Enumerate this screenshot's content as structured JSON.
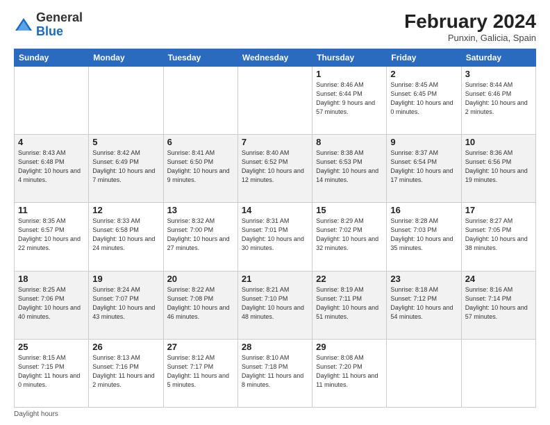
{
  "header": {
    "logo_general": "General",
    "logo_blue": "Blue",
    "month_year": "February 2024",
    "location": "Punxin, Galicia, Spain"
  },
  "weekdays": [
    "Sunday",
    "Monday",
    "Tuesday",
    "Wednesday",
    "Thursday",
    "Friday",
    "Saturday"
  ],
  "footer": {
    "daylight_label": "Daylight hours"
  },
  "weeks": [
    [
      {
        "day": "",
        "info": ""
      },
      {
        "day": "",
        "info": ""
      },
      {
        "day": "",
        "info": ""
      },
      {
        "day": "",
        "info": ""
      },
      {
        "day": "1",
        "info": "Sunrise: 8:46 AM\nSunset: 6:44 PM\nDaylight: 9 hours\nand 57 minutes."
      },
      {
        "day": "2",
        "info": "Sunrise: 8:45 AM\nSunset: 6:45 PM\nDaylight: 10 hours\nand 0 minutes."
      },
      {
        "day": "3",
        "info": "Sunrise: 8:44 AM\nSunset: 6:46 PM\nDaylight: 10 hours\nand 2 minutes."
      }
    ],
    [
      {
        "day": "4",
        "info": "Sunrise: 8:43 AM\nSunset: 6:48 PM\nDaylight: 10 hours\nand 4 minutes."
      },
      {
        "day": "5",
        "info": "Sunrise: 8:42 AM\nSunset: 6:49 PM\nDaylight: 10 hours\nand 7 minutes."
      },
      {
        "day": "6",
        "info": "Sunrise: 8:41 AM\nSunset: 6:50 PM\nDaylight: 10 hours\nand 9 minutes."
      },
      {
        "day": "7",
        "info": "Sunrise: 8:40 AM\nSunset: 6:52 PM\nDaylight: 10 hours\nand 12 minutes."
      },
      {
        "day": "8",
        "info": "Sunrise: 8:38 AM\nSunset: 6:53 PM\nDaylight: 10 hours\nand 14 minutes."
      },
      {
        "day": "9",
        "info": "Sunrise: 8:37 AM\nSunset: 6:54 PM\nDaylight: 10 hours\nand 17 minutes."
      },
      {
        "day": "10",
        "info": "Sunrise: 8:36 AM\nSunset: 6:56 PM\nDaylight: 10 hours\nand 19 minutes."
      }
    ],
    [
      {
        "day": "11",
        "info": "Sunrise: 8:35 AM\nSunset: 6:57 PM\nDaylight: 10 hours\nand 22 minutes."
      },
      {
        "day": "12",
        "info": "Sunrise: 8:33 AM\nSunset: 6:58 PM\nDaylight: 10 hours\nand 24 minutes."
      },
      {
        "day": "13",
        "info": "Sunrise: 8:32 AM\nSunset: 7:00 PM\nDaylight: 10 hours\nand 27 minutes."
      },
      {
        "day": "14",
        "info": "Sunrise: 8:31 AM\nSunset: 7:01 PM\nDaylight: 10 hours\nand 30 minutes."
      },
      {
        "day": "15",
        "info": "Sunrise: 8:29 AM\nSunset: 7:02 PM\nDaylight: 10 hours\nand 32 minutes."
      },
      {
        "day": "16",
        "info": "Sunrise: 8:28 AM\nSunset: 7:03 PM\nDaylight: 10 hours\nand 35 minutes."
      },
      {
        "day": "17",
        "info": "Sunrise: 8:27 AM\nSunset: 7:05 PM\nDaylight: 10 hours\nand 38 minutes."
      }
    ],
    [
      {
        "day": "18",
        "info": "Sunrise: 8:25 AM\nSunset: 7:06 PM\nDaylight: 10 hours\nand 40 minutes."
      },
      {
        "day": "19",
        "info": "Sunrise: 8:24 AM\nSunset: 7:07 PM\nDaylight: 10 hours\nand 43 minutes."
      },
      {
        "day": "20",
        "info": "Sunrise: 8:22 AM\nSunset: 7:08 PM\nDaylight: 10 hours\nand 46 minutes."
      },
      {
        "day": "21",
        "info": "Sunrise: 8:21 AM\nSunset: 7:10 PM\nDaylight: 10 hours\nand 48 minutes."
      },
      {
        "day": "22",
        "info": "Sunrise: 8:19 AM\nSunset: 7:11 PM\nDaylight: 10 hours\nand 51 minutes."
      },
      {
        "day": "23",
        "info": "Sunrise: 8:18 AM\nSunset: 7:12 PM\nDaylight: 10 hours\nand 54 minutes."
      },
      {
        "day": "24",
        "info": "Sunrise: 8:16 AM\nSunset: 7:14 PM\nDaylight: 10 hours\nand 57 minutes."
      }
    ],
    [
      {
        "day": "25",
        "info": "Sunrise: 8:15 AM\nSunset: 7:15 PM\nDaylight: 11 hours\nand 0 minutes."
      },
      {
        "day": "26",
        "info": "Sunrise: 8:13 AM\nSunset: 7:16 PM\nDaylight: 11 hours\nand 2 minutes."
      },
      {
        "day": "27",
        "info": "Sunrise: 8:12 AM\nSunset: 7:17 PM\nDaylight: 11 hours\nand 5 minutes."
      },
      {
        "day": "28",
        "info": "Sunrise: 8:10 AM\nSunset: 7:18 PM\nDaylight: 11 hours\nand 8 minutes."
      },
      {
        "day": "29",
        "info": "Sunrise: 8:08 AM\nSunset: 7:20 PM\nDaylight: 11 hours\nand 11 minutes."
      },
      {
        "day": "",
        "info": ""
      },
      {
        "day": "",
        "info": ""
      }
    ]
  ]
}
